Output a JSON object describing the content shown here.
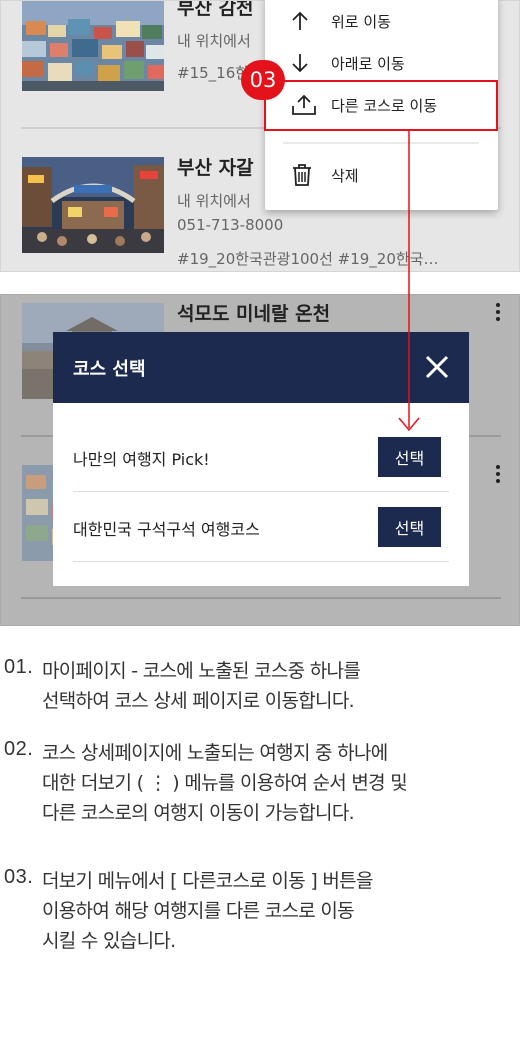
{
  "top_list": {
    "item1": {
      "title": "부산 감천",
      "subtitle": "내 위치에서",
      "tags": "#15_16한"
    },
    "item2": {
      "title": "부산 자갈",
      "subtitle": "내 위치에서",
      "phone": "051-713-8000",
      "tags": "#19_20한국관광100선  #19_20한국…"
    }
  },
  "menu": {
    "move_up": "위로 이동",
    "move_down": "아래로 이동",
    "move_other_course": "다른 코스로 이동",
    "delete": "삭제"
  },
  "step_badge": "03",
  "bottom_list": {
    "item1_title": "석모도 미네랄 온천"
  },
  "modal": {
    "title": "코스 선택",
    "courses": [
      {
        "name": "나만의 여행지 Pick!",
        "button": "선택"
      },
      {
        "name": "대한민국 구석구석 여행코스",
        "button": "선택"
      }
    ]
  },
  "instructions": [
    {
      "num": "01.",
      "lines": [
        "마이페이지 - 코스에 노출된 코스중 하나를",
        "선택하여 코스 상세 페이지로 이동합니다."
      ]
    },
    {
      "num": "02.",
      "lines": [
        "코스 상세페이지에 노출되는 여행지 중 하나에",
        "대한 더보기 ( ⋮ ) 메뉴를 이용하여 순서 변경 및",
        "다른 코스로의 여행지 이동이 가능합니다."
      ]
    },
    {
      "num": "03.",
      "lines": [
        "더보기 메뉴에서 [ 다른코스로 이동 ] 버튼을",
        "이용하여 해당 여행지를 다른 코스로 이동",
        "시킬 수 있습니다."
      ]
    }
  ],
  "colors": {
    "navy": "#1b2a4e",
    "highlight_red": "#e4121a"
  }
}
